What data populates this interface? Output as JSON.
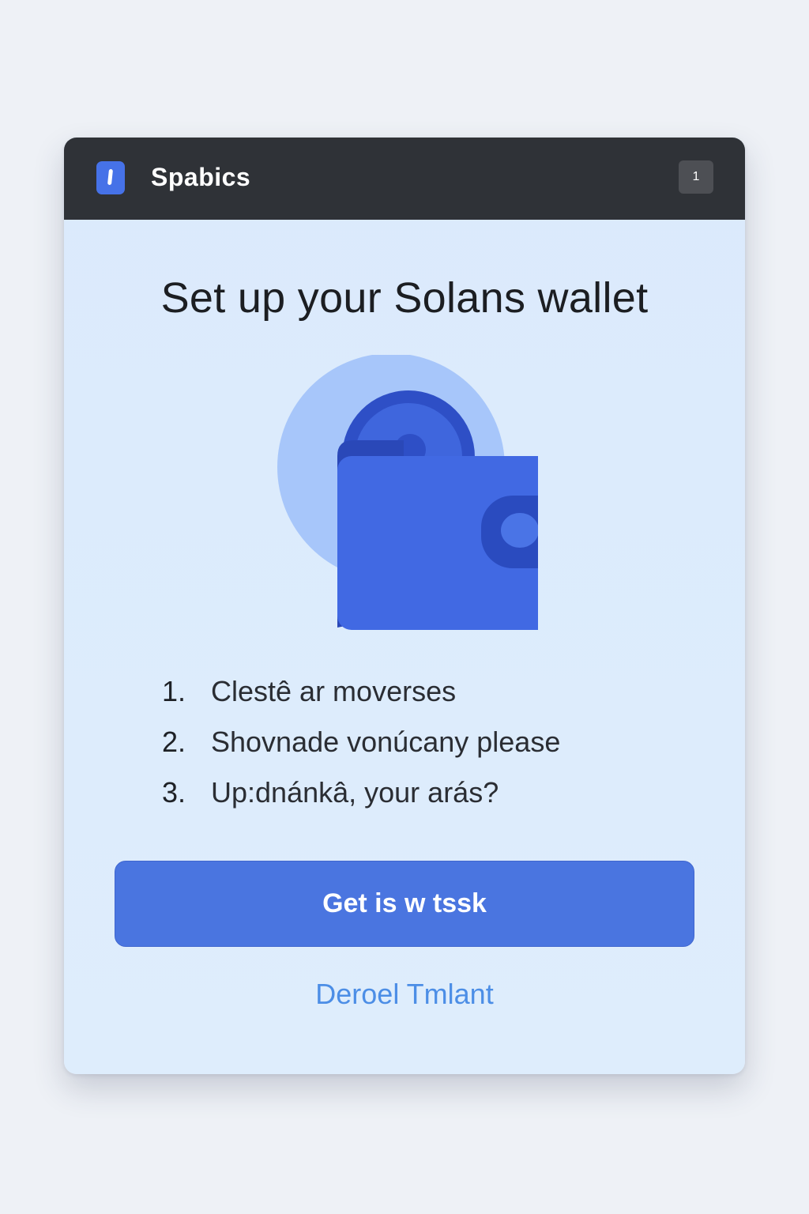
{
  "window": {
    "title": "Spabics",
    "button_label": "1",
    "app_icon": "app-icon"
  },
  "main": {
    "heading": "Set up your Solans wallet",
    "illustration": "wallet-illustration",
    "steps": [
      {
        "number": "1.",
        "text": "Clestê ar moverses"
      },
      {
        "number": "2.",
        "text": "Shovnade vonúcany please"
      },
      {
        "number": "3.",
        "text": "Up:dnánkâ, your arás?"
      }
    ],
    "primary_button": "Get is w tssk",
    "secondary_link": "Deroel Tmlant"
  },
  "colors": {
    "background": "#eef1f6",
    "titlebar": "#2f3237",
    "card": "#dbeafc",
    "accent": "#4a75e0",
    "link": "#4c8ee6"
  }
}
